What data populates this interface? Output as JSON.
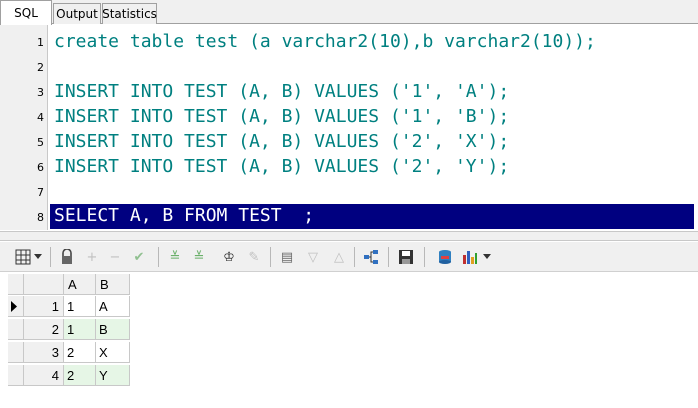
{
  "tabs": [
    {
      "label": "SQL",
      "active": true
    },
    {
      "label": "Output",
      "active": false
    },
    {
      "label": "Statistics",
      "active": false
    }
  ],
  "editor": {
    "lines": [
      {
        "num": "1",
        "text": "create table test (a varchar2(10),b varchar2(10));"
      },
      {
        "num": "2",
        "text": ""
      },
      {
        "num": "3",
        "text": "INSERT INTO TEST (A, B) VALUES ('1', 'A');"
      },
      {
        "num": "4",
        "text": "INSERT INTO TEST (A, B) VALUES ('1', 'B');"
      },
      {
        "num": "5",
        "text": "INSERT INTO TEST (A, B) VALUES ('2', 'X');"
      },
      {
        "num": "6",
        "text": "INSERT INTO TEST (A, B) VALUES ('2', 'Y');"
      },
      {
        "num": "7",
        "text": ""
      },
      {
        "num": "8",
        "text": "SELECT A, B FROM TEST  ;"
      }
    ],
    "selected_line": 8,
    "colors": {
      "keyword": "#00008b",
      "identifier": "#008080",
      "selection": "#000080"
    }
  },
  "toolbar": {
    "icons": [
      "grid-layout-icon",
      "lock-icon",
      "add-record-icon",
      "delete-record-icon",
      "post-edit-icon",
      "filter-icon",
      "filter-clear-icon",
      "find-icon",
      "clear-icon",
      "export-icon",
      "sort-ascending-icon",
      "sort-descending-icon",
      "tree-icon",
      "save-icon",
      "query-icon",
      "chart-icon"
    ]
  },
  "grid": {
    "columns": [
      "A",
      "B"
    ],
    "rows": [
      {
        "num": "1",
        "a": "1",
        "b": "A"
      },
      {
        "num": "2",
        "a": "1",
        "b": "B"
      },
      {
        "num": "3",
        "a": "2",
        "b": "X"
      },
      {
        "num": "4",
        "a": "2",
        "b": "Y"
      }
    ],
    "current_row": 1,
    "alt_row_color": "#e6f6e6"
  }
}
